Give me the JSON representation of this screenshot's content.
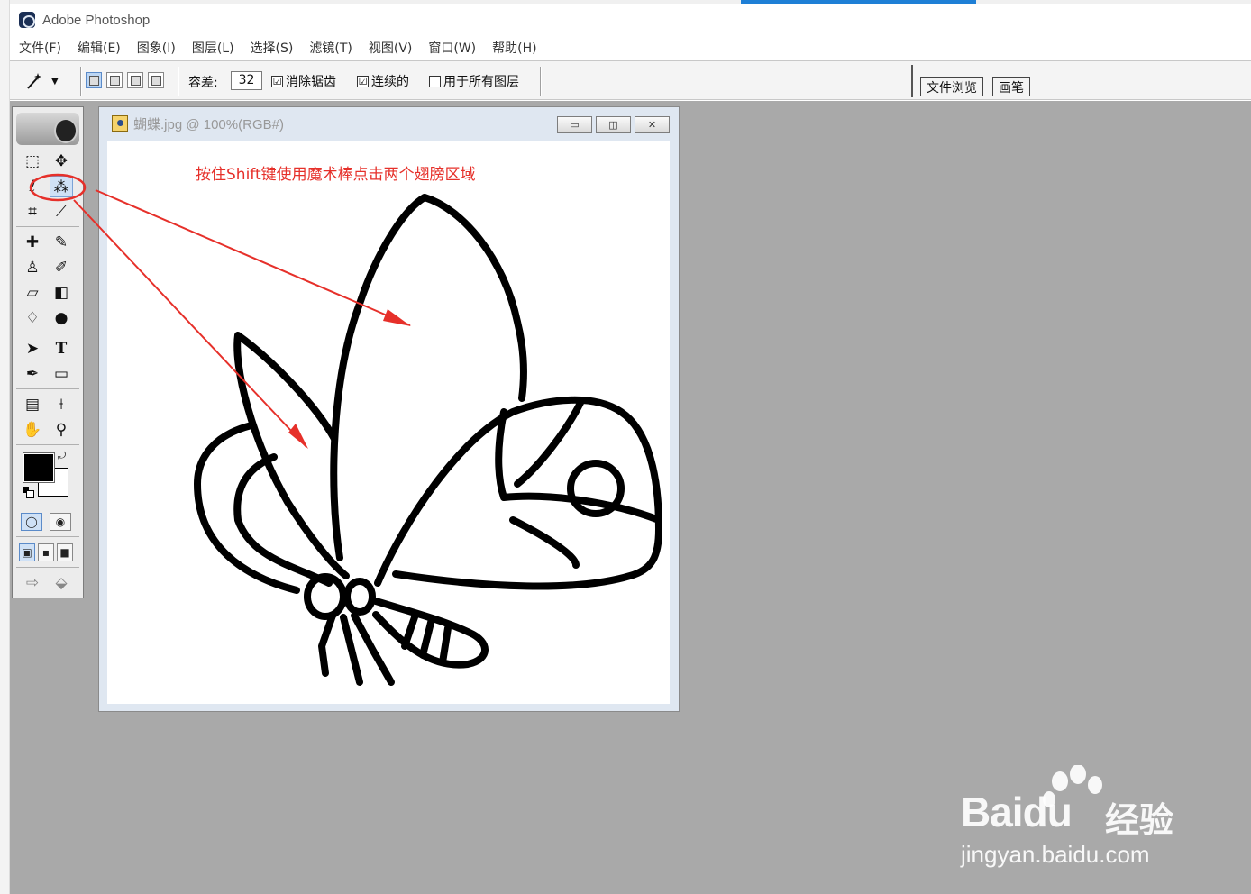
{
  "app": {
    "title": "Adobe Photoshop"
  },
  "menu": [
    "文件(F)",
    "编辑(E)",
    "图象(I)",
    "图层(L)",
    "选择(S)",
    "滤镜(T)",
    "视图(V)",
    "窗口(W)",
    "帮助(H)"
  ],
  "options": {
    "tolerance_label": "容差:",
    "tolerance_value": "32",
    "anti_alias_label": "消除锯齿",
    "contiguous_label": "连续的",
    "all_layers_label": "用于所有图层",
    "anti_alias_checked": "☑",
    "contiguous_checked": "☑"
  },
  "palette_well": {
    "tabs": [
      "文件浏览",
      "画笔"
    ]
  },
  "document": {
    "title": "蝴蝶.jpg @ 100%(RGB#)",
    "annotation": "按住Shift键使用魔术棒点击两个翅膀区域"
  },
  "window_buttons": {
    "minimize": "▭",
    "restore": "◫",
    "close": "✕"
  },
  "watermark": {
    "brand": "Bai",
    "brand_du": "du",
    "jingyan": "经验",
    "url": "jingyan.baidu.com"
  },
  "colors": {
    "workspace": "#a9a9a9",
    "annotation_red": "#e6302a",
    "highlight_blue": "#1e7fd6"
  },
  "icons": {
    "toolbox": [
      "marquee-icon",
      "move-icon",
      "lasso-icon",
      "magic-wand-icon",
      "crop-icon",
      "slice-icon",
      "healing-brush-icon",
      "brush-icon",
      "clone-stamp-icon",
      "history-brush-icon",
      "eraser-icon",
      "gradient-icon",
      "blur-icon",
      "dodge-icon",
      "path-select-icon",
      "type-icon",
      "pen-icon",
      "shape-icon",
      "notes-icon",
      "eyedropper-icon",
      "hand-icon",
      "zoom-icon"
    ]
  }
}
